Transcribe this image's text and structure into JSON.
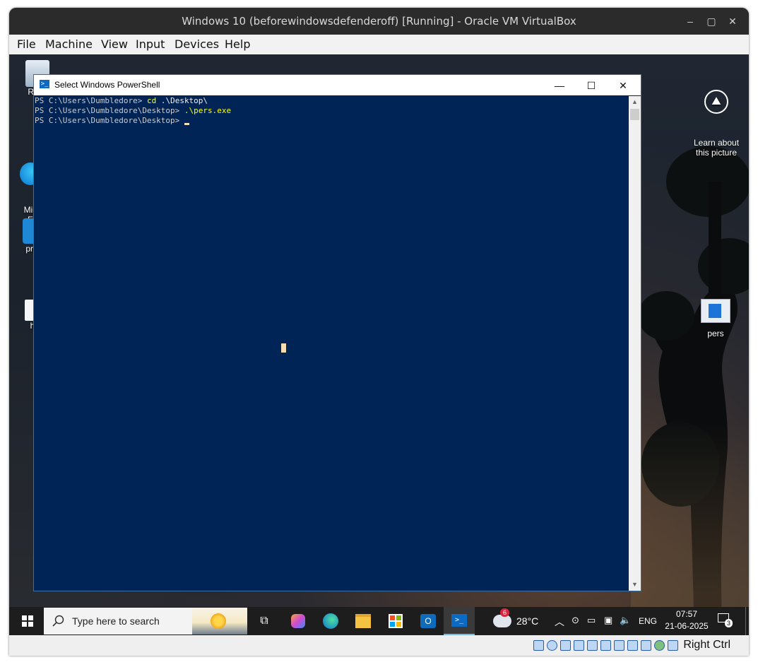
{
  "vbox": {
    "title": "Windows 10 (beforewindowsdefenderoff) [Running] - Oracle VM VirtualBox",
    "menu": [
      "File",
      "Machine",
      "View",
      "Input",
      "Devices",
      "Help"
    ],
    "host_key": "Right Ctrl"
  },
  "desktop": {
    "icons_left": [
      {
        "label": "Recy",
        "icon": "recycle-bin-icon"
      },
      {
        "label": "Mic\nE",
        "icon": "edge-icon"
      },
      {
        "label": "pro",
        "icon": "app-icon"
      },
      {
        "label": "h",
        "icon": "file-icon"
      }
    ],
    "learn_about": {
      "label": "Learn about\nthis picture",
      "icon": "camera-info-icon"
    },
    "pers": {
      "label": "pers",
      "icon": "exe-icon"
    }
  },
  "powershell": {
    "title": "Select Windows PowerShell",
    "lines": [
      {
        "prompt": "PS C:\\Users\\Dumbledore> ",
        "cmd": "cd",
        "arg": " .\\Desktop\\"
      },
      {
        "prompt": "PS C:\\Users\\Dumbledore\\Desktop> ",
        "cmd": ".\\pers.exe",
        "arg": ""
      },
      {
        "prompt": "PS C:\\Users\\Dumbledore\\Desktop> ",
        "cmd": "",
        "arg": ""
      }
    ]
  },
  "taskbar": {
    "search_placeholder": "Type here to search",
    "weather": {
      "temp": "28°C",
      "badge": "6"
    },
    "language": "ENG",
    "time": "07:57",
    "date": "21-06-2025",
    "notifications": "3"
  }
}
